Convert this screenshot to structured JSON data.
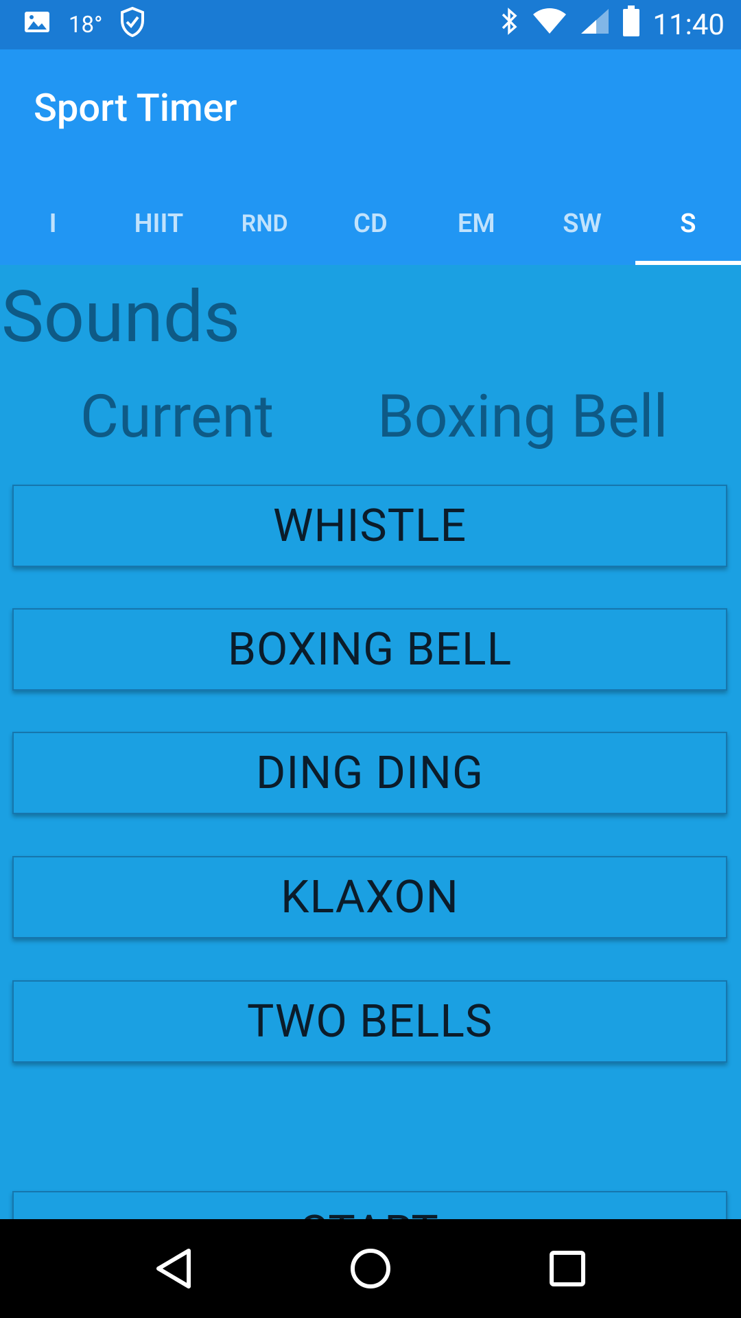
{
  "status_bar": {
    "temperature": "18°",
    "time": "11:40"
  },
  "app": {
    "title": "Sport Timer"
  },
  "tabs": [
    {
      "label": "I"
    },
    {
      "label": "HIIT"
    },
    {
      "label": "RND"
    },
    {
      "label": "CD"
    },
    {
      "label": "EM"
    },
    {
      "label": "SW"
    },
    {
      "label": "S",
      "active": true
    }
  ],
  "sounds": {
    "title": "Sounds",
    "current_label": "Current",
    "current_value": "Boxing Bell",
    "buttons": [
      "WHISTLE",
      "BOXING BELL",
      "DING DING",
      "KLAXON",
      "TWO BELLS"
    ],
    "start_label": "START"
  }
}
